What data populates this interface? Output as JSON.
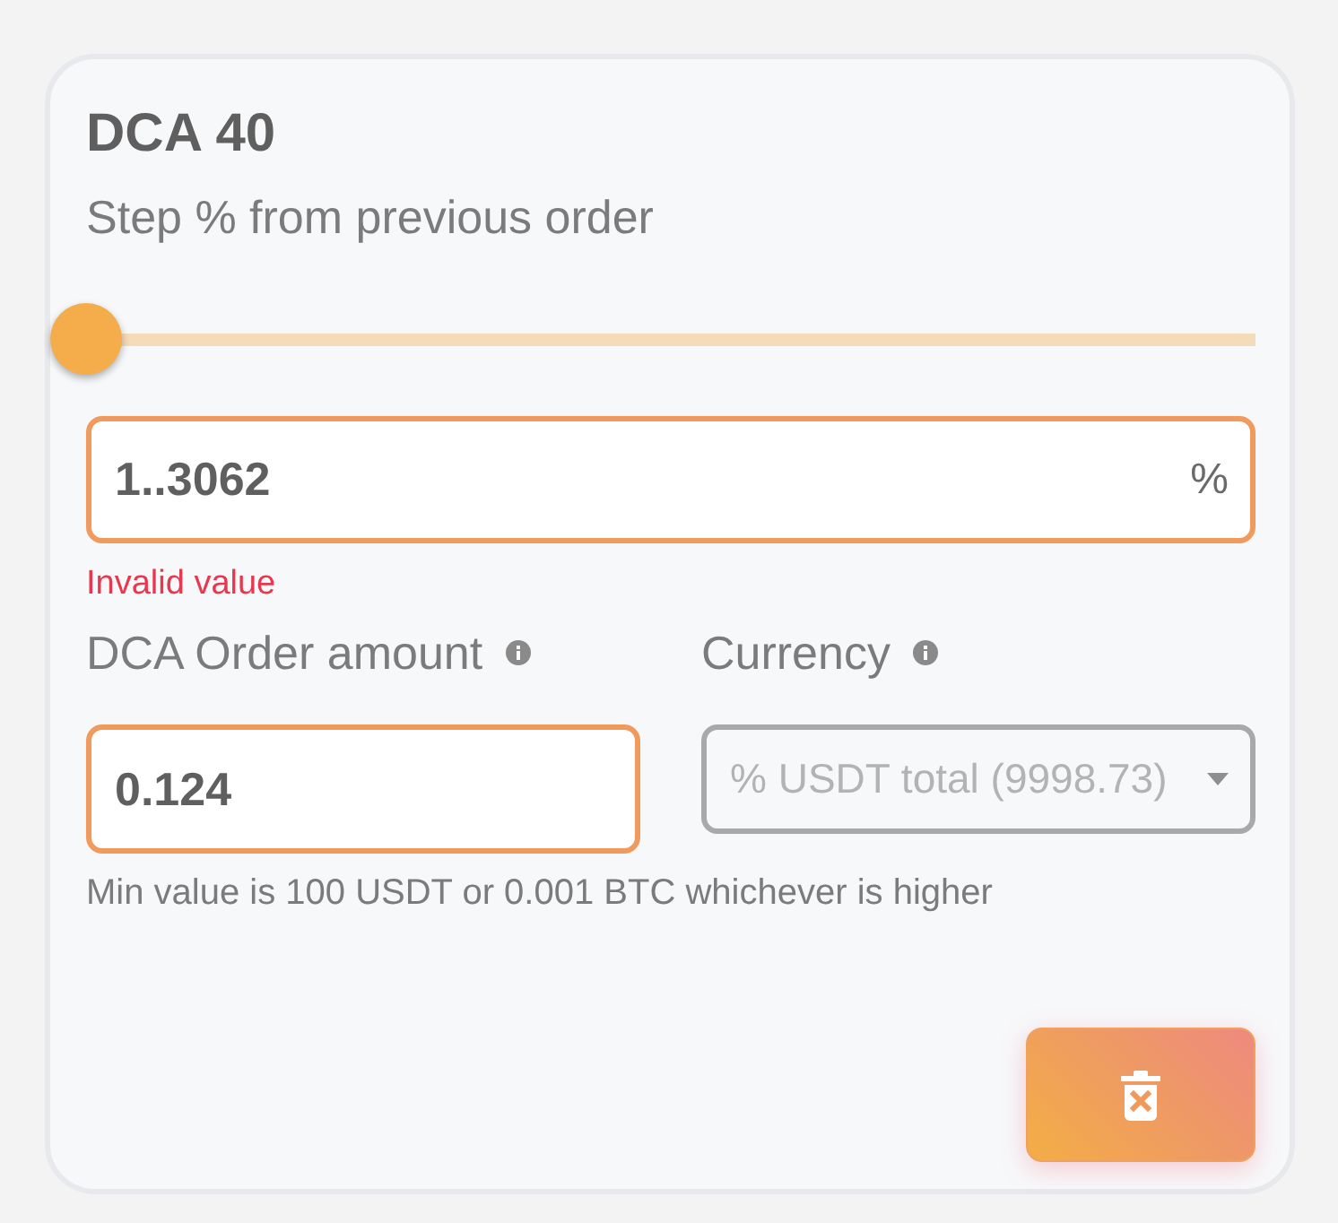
{
  "card": {
    "title": "DCA 40",
    "step": {
      "label": "Step % from previous order",
      "slider": {
        "level": 0
      },
      "field": {
        "value": "1..3062",
        "unit": "%",
        "disabled": false
      },
      "error": "Invalid value"
    },
    "amount": {
      "label": "DCA Order amount",
      "field": {
        "value": "0.124",
        "disabled": false
      }
    },
    "currency": {
      "label": "Currency",
      "select": {
        "value": "% USDT total (9998.73)",
        "disabled": true
      }
    },
    "hint": "Min value is 100 USDT or 0.001 BTC whichever is higher"
  }
}
